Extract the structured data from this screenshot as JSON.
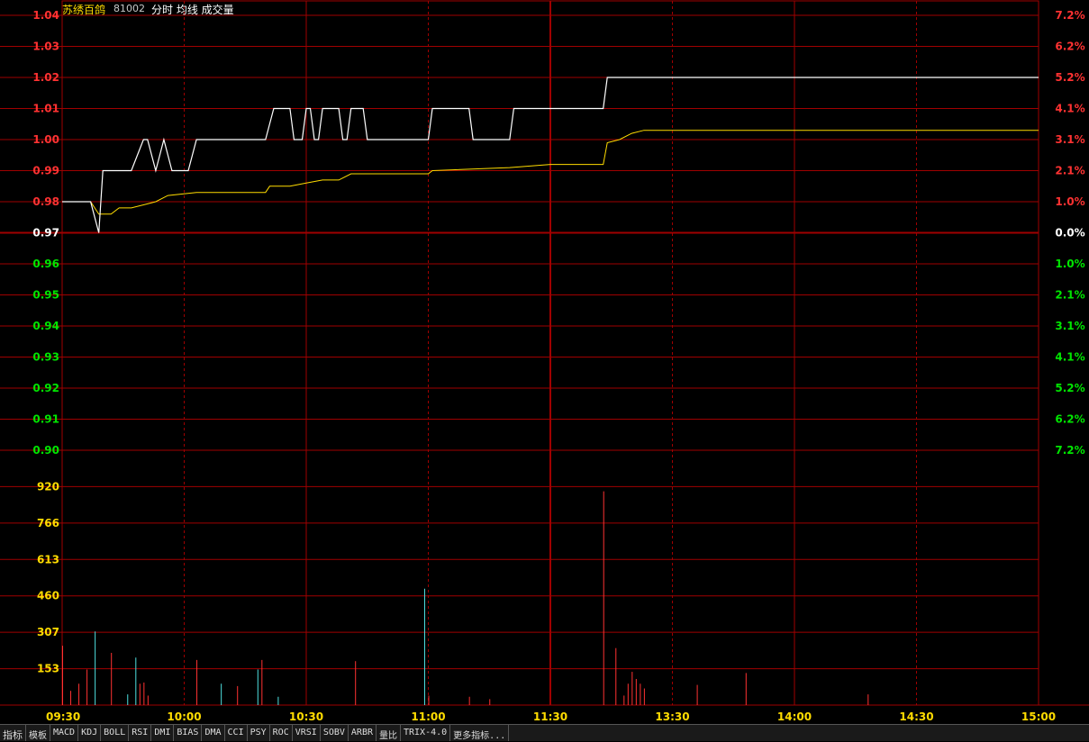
{
  "header": {
    "name": "苏绣百鸽",
    "code": "81002",
    "labels": "分时 均线 成交量"
  },
  "colors": {
    "grid": "#a00000",
    "up": "#ff3232",
    "down": "#00e600",
    "volume_axis": "#ffdc00",
    "price_line": "#ffffff",
    "avg_line": "#ffdc00",
    "volume_down": "#4ee0e0"
  },
  "tabs": [
    "指标",
    "模板",
    "MACD",
    "KDJ",
    "BOLL",
    "RSI",
    "DMI",
    "BIAS",
    "DMA",
    "CCI",
    "PSY",
    "ROC",
    "VRSI",
    "SOBV",
    "ARBR",
    "量比",
    "TRIX-4.0",
    "更多指标..."
  ],
  "chart_data": {
    "type": "line",
    "prev_close": 0.97,
    "price_axis": {
      "ticks": [
        {
          "v": "1.04",
          "c": "up"
        },
        {
          "v": "1.03",
          "c": "up"
        },
        {
          "v": "1.02",
          "c": "up"
        },
        {
          "v": "1.01",
          "c": "up"
        },
        {
          "v": "1.00",
          "c": "up"
        },
        {
          "v": "0.99",
          "c": "up"
        },
        {
          "v": "0.98",
          "c": "up"
        },
        {
          "v": "0.97",
          "c": "flat"
        },
        {
          "v": "0.96",
          "c": "down"
        },
        {
          "v": "0.95",
          "c": "down"
        },
        {
          "v": "0.94",
          "c": "down"
        },
        {
          "v": "0.93",
          "c": "down"
        },
        {
          "v": "0.92",
          "c": "down"
        },
        {
          "v": "0.91",
          "c": "down"
        },
        {
          "v": "0.90",
          "c": "down"
        }
      ],
      "ylim": [
        0.9,
        1.04
      ]
    },
    "pct_axis": [
      "7.2%",
      "6.2%",
      "5.2%",
      "4.1%",
      "3.1%",
      "2.1%",
      "1.0%",
      "0.0%",
      "1.0%",
      "2.1%",
      "3.1%",
      "4.1%",
      "5.2%",
      "6.2%",
      "7.2%"
    ],
    "volume_axis": {
      "ticks": [
        "920",
        "766",
        "613",
        "460",
        "307",
        "153"
      ],
      "ylim": [
        0,
        1073
      ]
    },
    "time_labels": [
      "09:30",
      "10:00",
      "10:30",
      "11:00",
      "11:30",
      "13:30",
      "14:00",
      "14:30",
      "15:00"
    ],
    "minutes": 240,
    "price_series": [
      [
        0,
        0.98
      ],
      [
        7,
        0.98
      ],
      [
        9,
        0.97
      ],
      [
        10,
        0.99
      ],
      [
        17,
        0.99
      ],
      [
        20,
        1.0
      ],
      [
        21,
        1.0
      ],
      [
        23,
        0.99
      ],
      [
        25,
        1.0
      ],
      [
        27,
        0.99
      ],
      [
        31,
        0.99
      ],
      [
        33,
        1.0
      ],
      [
        50,
        1.0
      ],
      [
        52,
        1.01
      ],
      [
        56,
        1.01
      ],
      [
        57,
        1.0
      ],
      [
        59,
        1.0
      ],
      [
        60,
        1.01
      ],
      [
        61,
        1.01
      ],
      [
        62,
        1.0
      ],
      [
        63,
        1.0
      ],
      [
        64,
        1.01
      ],
      [
        68,
        1.01
      ],
      [
        69,
        1.0
      ],
      [
        70,
        1.0
      ],
      [
        71,
        1.01
      ],
      [
        74,
        1.01
      ],
      [
        75,
        1.0
      ],
      [
        90,
        1.0
      ],
      [
        91,
        1.01
      ],
      [
        100,
        1.01
      ],
      [
        101,
        1.0
      ],
      [
        110,
        1.0
      ],
      [
        111,
        1.01
      ],
      [
        133,
        1.01
      ],
      [
        134,
        1.02
      ],
      [
        240,
        1.02
      ]
    ],
    "avg_series": [
      [
        0,
        0.98
      ],
      [
        7,
        0.98
      ],
      [
        9,
        0.976
      ],
      [
        12,
        0.976
      ],
      [
        14,
        0.978
      ],
      [
        17,
        0.978
      ],
      [
        20,
        0.979
      ],
      [
        23,
        0.98
      ],
      [
        26,
        0.982
      ],
      [
        33,
        0.983
      ],
      [
        50,
        0.983
      ],
      [
        51,
        0.985
      ],
      [
        56,
        0.985
      ],
      [
        60,
        0.986
      ],
      [
        64,
        0.987
      ],
      [
        68,
        0.987
      ],
      [
        71,
        0.989
      ],
      [
        80,
        0.989
      ],
      [
        90,
        0.989
      ],
      [
        91,
        0.99
      ],
      [
        110,
        0.991
      ],
      [
        120,
        0.992
      ],
      [
        133,
        0.992
      ],
      [
        134,
        0.999
      ],
      [
        137,
        1.0
      ],
      [
        140,
        1.002
      ],
      [
        143,
        1.003
      ],
      [
        200,
        1.003
      ],
      [
        240,
        1.003
      ]
    ],
    "volume_series": [
      [
        0,
        250,
        "up"
      ],
      [
        2,
        60,
        "up"
      ],
      [
        4,
        90,
        "up"
      ],
      [
        6,
        150,
        "up"
      ],
      [
        8,
        310,
        "down"
      ],
      [
        12,
        220,
        "up"
      ],
      [
        16,
        45,
        "down"
      ],
      [
        18,
        200,
        "down"
      ],
      [
        19,
        90,
        "up"
      ],
      [
        20,
        95,
        "up"
      ],
      [
        21,
        40,
        "up"
      ],
      [
        33,
        190,
        "up"
      ],
      [
        39,
        90,
        "down"
      ],
      [
        43,
        80,
        "up"
      ],
      [
        48,
        150,
        "down"
      ],
      [
        49,
        190,
        "up"
      ],
      [
        53,
        35,
        "down"
      ],
      [
        72,
        185,
        "up"
      ],
      [
        89,
        490,
        "down"
      ],
      [
        90,
        40,
        "up"
      ],
      [
        100,
        35,
        "up"
      ],
      [
        105,
        25,
        "up"
      ],
      [
        133,
        900,
        "up"
      ],
      [
        136,
        240,
        "up"
      ],
      [
        138,
        40,
        "up"
      ],
      [
        139,
        90,
        "up"
      ],
      [
        140,
        140,
        "up"
      ],
      [
        141,
        110,
        "up"
      ],
      [
        142,
        90,
        "up"
      ],
      [
        143,
        70,
        "up"
      ],
      [
        156,
        85,
        "up"
      ],
      [
        168,
        135,
        "up"
      ],
      [
        198,
        45,
        "up"
      ]
    ]
  }
}
